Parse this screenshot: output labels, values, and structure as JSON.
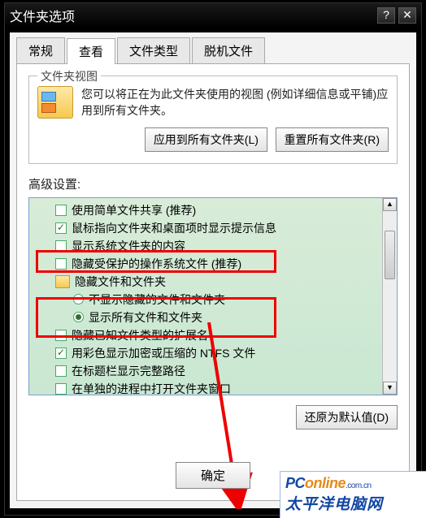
{
  "title": "文件夹选项",
  "titlebar_help": "?",
  "titlebar_close": "✕",
  "tabs": {
    "general": "常规",
    "view": "查看",
    "types": "文件类型",
    "offline": "脱机文件"
  },
  "views_group": {
    "title": "文件夹视图",
    "desc": "您可以将正在为此文件夹使用的视图 (例如详细信息或平铺)应用到所有文件夹。",
    "apply_btn": "应用到所有文件夹(L)",
    "reset_btn": "重置所有文件夹(R)"
  },
  "adv_label": "高级设置:",
  "tree": {
    "r0": "使用简单文件共享 (推荐)",
    "r1": "鼠标指向文件夹和桌面项时显示提示信息",
    "r2": "显示系统文件夹的内容",
    "r3": "隐藏受保护的操作系统文件 (推荐)",
    "r4": "隐藏文件和文件夹",
    "r5": "不显示隐藏的文件和文件夹",
    "r6": "显示所有文件和文件夹",
    "r7": "隐藏已知文件类型的扩展名",
    "r8": "用彩色显示加密或压缩的 NTFS 文件",
    "r9": "在标题栏显示完整路径",
    "r10": "在单独的进程中打开文件夹窗口"
  },
  "scroll_up": "▲",
  "scroll_down": "▼",
  "restore_btn": "还原为默认值(D)",
  "ok_btn": "确定",
  "watermark": {
    "pc": "PC",
    "online": "online",
    "suffix": ".com.cn",
    "cn": "太平洋电脑网"
  }
}
